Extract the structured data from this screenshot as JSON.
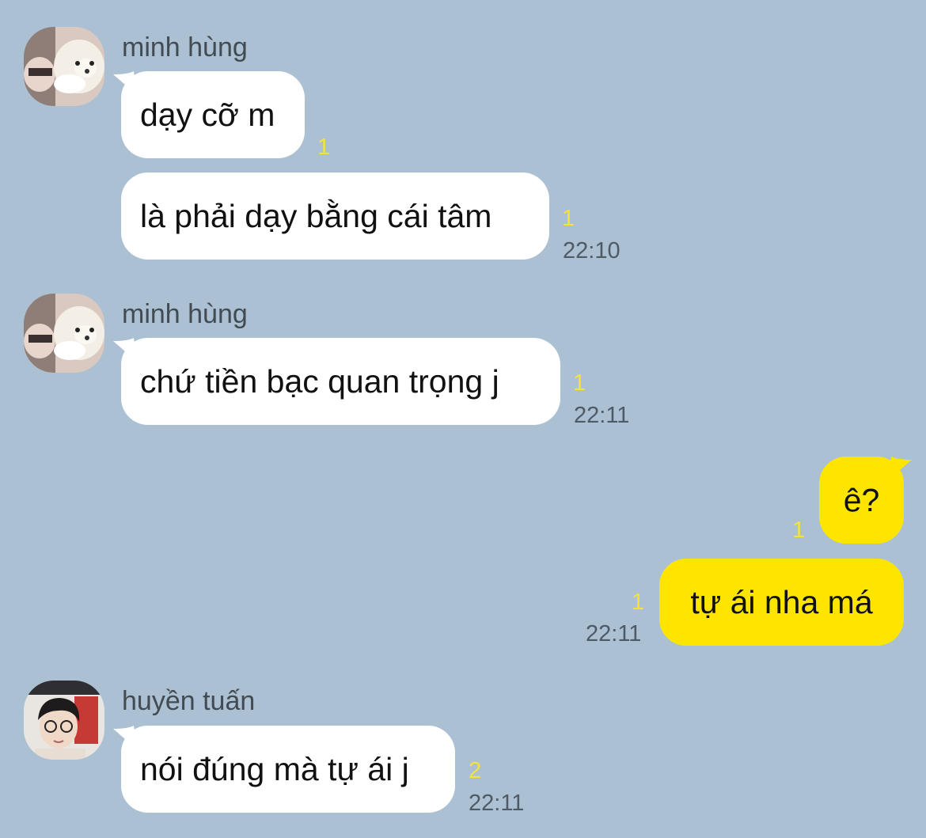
{
  "colors": {
    "background": "#abc1d3",
    "incoming_bubble": "#ffffff",
    "outgoing_bubble": "#fee500",
    "unread": "#f3e33b",
    "time": "#4e5a66",
    "sender": "#424a52"
  },
  "groups": [
    {
      "sender": "minh hùng",
      "avatar_icon": "dog-photo-avatar",
      "messages": [
        {
          "text": "dạy cỡ m",
          "unread": "1"
        },
        {
          "text": "là phải dạy bằng cái tâm",
          "unread": "1",
          "time": "22:10"
        }
      ]
    },
    {
      "sender": "minh hùng",
      "avatar_icon": "dog-photo-avatar",
      "messages": [
        {
          "text": "chứ tiền bạc quan trọng j",
          "unread": "1",
          "time": "22:11"
        }
      ]
    },
    {
      "sender": "",
      "outgoing": true,
      "messages": [
        {
          "text": "ê?",
          "unread": "1"
        },
        {
          "text": "tự ái nha má",
          "unread": "1",
          "time": "22:11"
        }
      ]
    },
    {
      "sender": "huyền tuấn",
      "avatar_icon": "person-photo-avatar",
      "messages": [
        {
          "text": "nói đúng mà tự ái j",
          "unread": "2",
          "time": "22:11"
        }
      ]
    }
  ]
}
